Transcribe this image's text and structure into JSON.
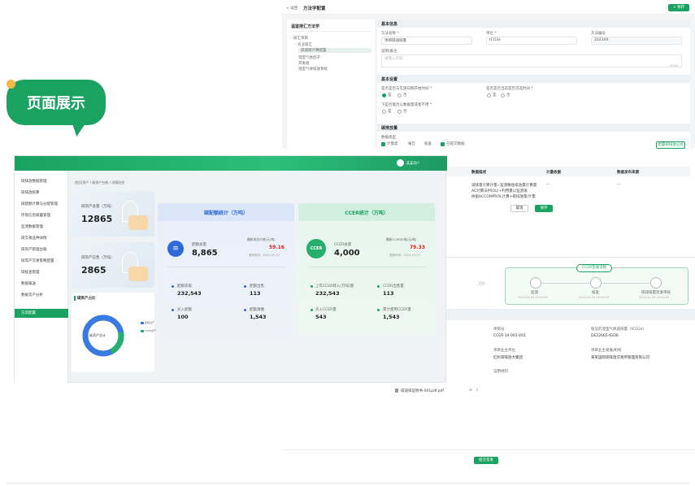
{
  "badge": {
    "label": "页面展示"
  },
  "detail_page": {
    "breadcrumb": {
      "back": "< 返回",
      "title": "方法学配置"
    },
    "save_top_label": "+ 保存",
    "tree": {
      "title": "温室排汇方法学",
      "items": [
        "- 碳汇项目",
        "- 农业碳汇",
        "碳减排计算配置",
        "温室气体因子",
        "开发组",
        "温室气体排放系统"
      ]
    },
    "basic_info": {
      "header": "基本信息",
      "name_label": "方法名称 *",
      "name_value": "项目碳减排量",
      "unit_label": "单位 *",
      "unit_value": "tCO2e",
      "code_label": "方法编号",
      "code_value": "2023XX",
      "desc_label": "说明/备注",
      "desc_placeholder": "请输入内容",
      "desc_counter": "0/500"
    },
    "basic_settings": {
      "header": "基本设置",
      "q1": "是否是否与实施日期开始时间 *",
      "q2": "是否是否当前是否可选时间 *",
      "q3": "下是否能否以数据量或者不用 *",
      "yes": "是",
      "no": "否"
    },
    "calc": {
      "header": "碳排放量",
      "type_label": "数据类型",
      "options": [
        "计量类",
        "报告",
        "核查",
        "已提交数据"
      ],
      "button": "配置碳排放公式"
    },
    "table": {
      "headers": [
        "数据描述",
        "计量依据",
        "数据发布来源"
      ],
      "rows": [
        "减排量计算计量=监测数值排放量计算量",
        "AC计算法PRO以+利用量以监测值",
        "依据ACCOMPROL计算+碳排放量/计量"
      ],
      "dash": "—"
    },
    "cancel_label": "取消",
    "confirm_label": "保存"
  },
  "dashboard": {
    "user": "某某用户",
    "sidebar": [
      "碳排放数据管理",
      "碳排放核算",
      "碳配额计算与分配管理",
      "环境信息披露管理",
      "监测数据管理",
      "碳交易品种详情",
      "碳资产管理台账",
      "碳资产交易策略配置",
      "碳核查管理",
      "数据报送",
      "数据资产分析",
      "方案配置"
    ],
    "sidebar_active_index": 11,
    "breadcrumb": "首页/资产 / 碳资产台账 / 详情信息",
    "asset_total": {
      "label": "碳资产总量（万吨）",
      "value": "12865"
    },
    "asset_sold": {
      "label": "碳资产已售（万吨）",
      "value": "2865"
    },
    "donut": {
      "title": "碳资产占比",
      "center": "碳资产总计",
      "legend": [
        "配额资产",
        "CCER资产"
      ]
    },
    "quota": {
      "title": "碳配额统计（万吨）",
      "total_label": "配额总量",
      "total_value": "8,865",
      "price_label": "最新成交价格(元/吨)",
      "price_value": "59.16",
      "time_label": "更新时间：2024-05-23",
      "metrics": [
        {
          "label": "配额获取",
          "value": "232,543"
        },
        {
          "label": "配额出售",
          "value": "113"
        },
        {
          "label": "买入配额",
          "value": "100"
        },
        {
          "label": "配额清缴",
          "value": "1,543"
        }
      ]
    },
    "ccer": {
      "title": "CCER统计（万吨）",
      "total_label": "CCER总量",
      "total_value": "4,000",
      "price_label": "最新CCER价格(元/吨)",
      "price_value": "79.33",
      "time_label": "更新时间：2024-05-23",
      "icon_text": "CCER",
      "metrics": [
        {
          "label": "上年CCER转入(万吨)量",
          "value": "232,543"
        },
        {
          "label": "CCER出售量",
          "value": "113"
        },
        {
          "label": "买入CCER量",
          "value": "543"
        },
        {
          "label": "累计使用CCER量",
          "value": "1,543"
        }
      ]
    }
  },
  "flow": {
    "title": "CCER签发流程",
    "steps": [
      {
        "label": "监测",
        "date": "2024-04-03 03:04:03"
      },
      {
        "label": "核查",
        "date": "2024-04-03 03:04:03"
      },
      {
        "label": "碳减排量签发审核",
        "date": "2024-04-05 03:04:03"
      }
    ]
  },
  "project_info": {
    "fields": [
      {
        "label": "项目号",
        "value": "CCER-14-001-V01"
      },
      {
        "label": "核证的温室气体减排量（tCO2e）",
        "value": "DE22665-6336"
      },
      {
        "label": "项目业主单位",
        "value": "红杉碳排放大集团"
      },
      {
        "label": "项目业主发展/机构",
        "value": "某某国际碳排放交易所管理有限公司"
      },
      {
        "label": "证明材料",
        "value": ""
      }
    ],
    "attachment": "碳减排证明书-001pdf.pdf",
    "submit_label": "提交签发"
  },
  "colors": {
    "primary": "#1aa260",
    "price_red": "#e02020",
    "blue_accent": "#2f6bd8"
  }
}
